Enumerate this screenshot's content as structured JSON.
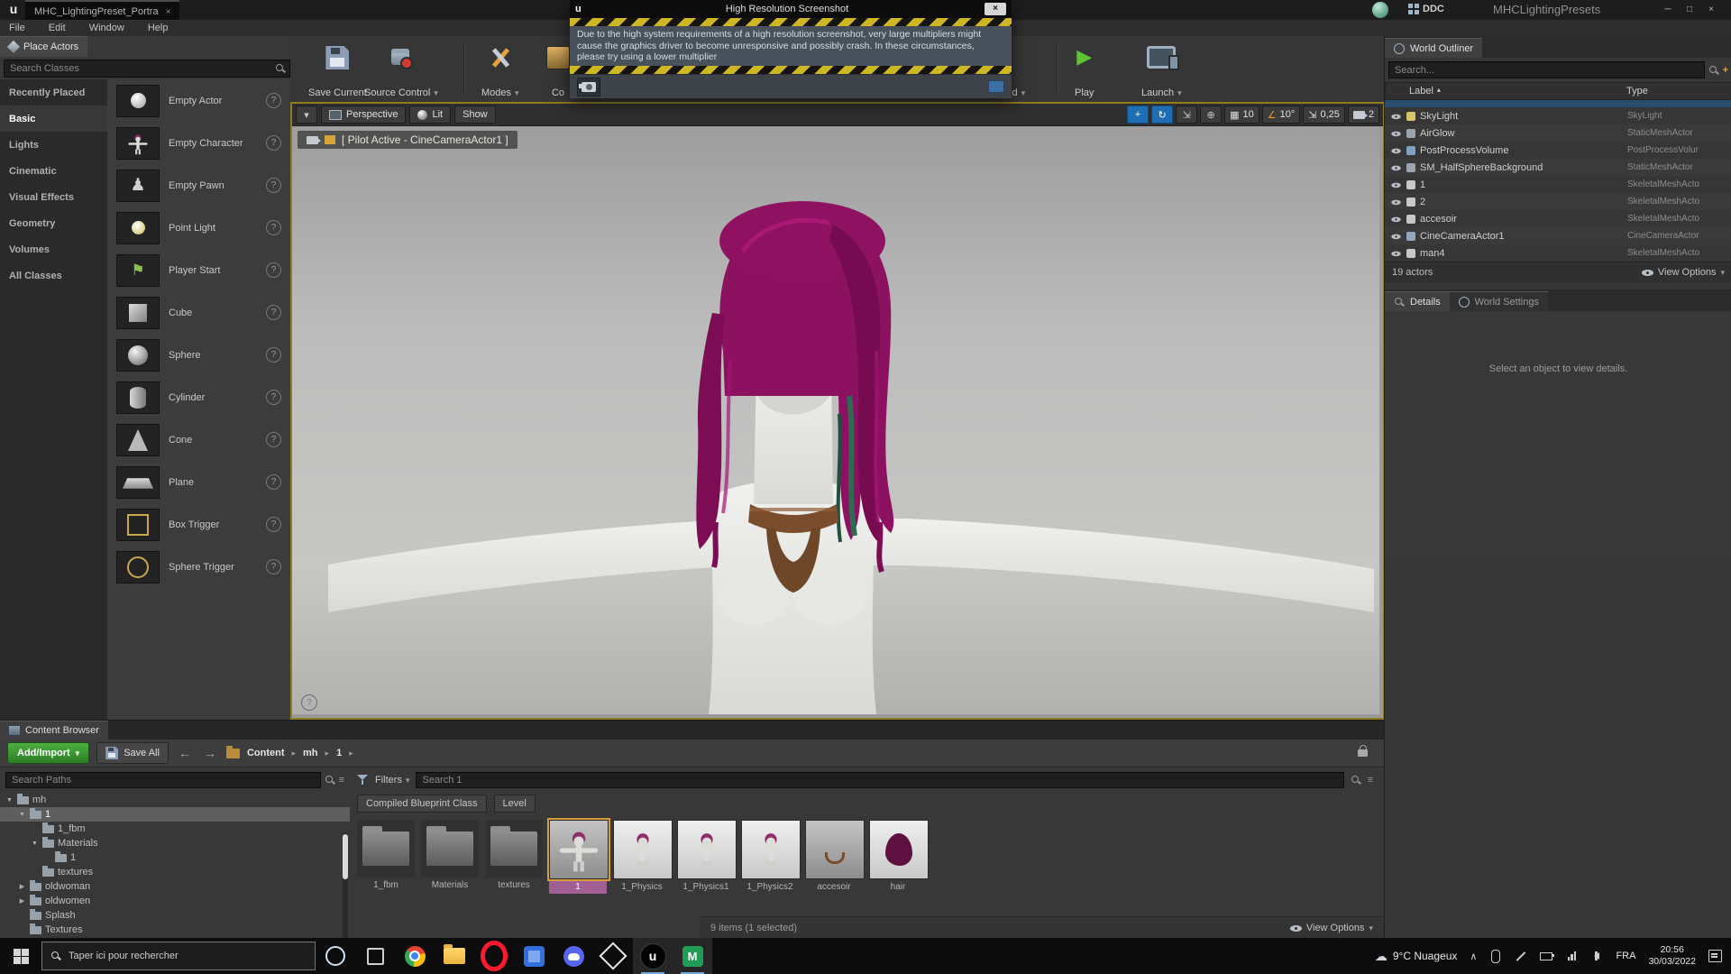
{
  "icons": {
    "ue": "u",
    "m": "M",
    "close": "×",
    "minimize": "─",
    "maximize": "□",
    "caret": "▾",
    "crumb": "▸",
    "back": "←",
    "forward": "→",
    "tree_open": "▼",
    "tree_closed": "▶",
    "play": "▶",
    "help": "?",
    "chevron_up": "∧",
    "list": "≡",
    "plus": "+",
    "rotate": "↻",
    "scale": "⇲",
    "globe": "⊕",
    "grid": "▦",
    "angle": "∠",
    "pawn": "♟",
    "flag": "⚑",
    "sort": "▴",
    "cloud": "☁"
  },
  "titlebar": {
    "tab": "MHC_LightingPreset_Portra",
    "ddc": "DDC",
    "app_title": "MHCLightingPresets"
  },
  "menubar": {
    "items": [
      "File",
      "Edit",
      "Window",
      "Help"
    ]
  },
  "place_actors": {
    "tab_title": "Place Actors",
    "search_placeholder": "Search Classes",
    "categories": [
      "Recently Placed",
      "Basic",
      "Lights",
      "Cinematic",
      "Visual Effects",
      "Geometry",
      "Volumes",
      "All Classes"
    ],
    "items": [
      "Empty Actor",
      "Empty Character",
      "Empty Pawn",
      "Point Light",
      "Player Start",
      "Cube",
      "Sphere",
      "Cylinder",
      "Cone",
      "Plane",
      "Box Trigger",
      "Sphere Trigger"
    ]
  },
  "toolbar": {
    "save_current": "Save Current",
    "source_control": "Source Control",
    "modes": "Modes",
    "content_label": "Co",
    "build_label": "ld",
    "play": "Play",
    "launch": "Launch"
  },
  "dialog": {
    "title": "High Resolution Screenshot",
    "body": "Due to the high system requirements of a high resolution screenshot, very large multipliers might cause the graphics driver to become unresponsive and possibly crash. In these circumstances, please try using a lower multiplier"
  },
  "viewport": {
    "perspective": "Perspective",
    "lit": "Lit",
    "show": "Show",
    "pilot": "[ Pilot Active - CineCameraActor1 ]",
    "grid_snap": "10",
    "rotation_snap": "10°",
    "scale_snap": "0,25",
    "camera_speed": "2"
  },
  "outliner": {
    "tab_title": "World Outliner",
    "search_placeholder": "Search...",
    "columns": {
      "label": "Label",
      "type": "Type"
    },
    "rows": [
      {
        "label": "SkyLight",
        "type": "SkyLight"
      },
      {
        "label": "AirGlow",
        "type": "StaticMeshActor"
      },
      {
        "label": "PostProcessVolume",
        "type": "PostProcessVolur"
      },
      {
        "label": "SM_HalfSphereBackground",
        "type": "StaticMeshActor"
      },
      {
        "label": "1",
        "type": "SkeletalMeshActo"
      },
      {
        "label": "2",
        "type": "SkeletalMeshActo"
      },
      {
        "label": "accesoir",
        "type": "SkeletalMeshActo"
      },
      {
        "label": "CineCameraActor1",
        "type": "CineCameraActor"
      },
      {
        "label": "man4",
        "type": "SkeletalMeshActo"
      }
    ],
    "status": "19 actors",
    "view_options": "View Options"
  },
  "details": {
    "tab_details": "Details",
    "tab_world_settings": "World Settings",
    "empty_text": "Select an object to view details."
  },
  "content_browser": {
    "tab_title": "Content Browser",
    "add_import": "Add/Import",
    "save_all": "Save All",
    "breadcrumbs": [
      "Content",
      "mh",
      "1"
    ],
    "search_paths_placeholder": "Search Paths",
    "filters_label": "Filters",
    "search_placeholder": "Search 1",
    "chips": [
      "Compiled Blueprint Class",
      "Level"
    ],
    "tree": [
      {
        "label": "mh"
      },
      {
        "label": "1"
      },
      {
        "label": "1_fbm"
      },
      {
        "label": "Materials"
      },
      {
        "label": "1"
      },
      {
        "label": "textures"
      },
      {
        "label": "oldwoman"
      },
      {
        "label": "oldwomen"
      },
      {
        "label": "Splash"
      },
      {
        "label": "Textures"
      }
    ],
    "assets": [
      {
        "name": "1_fbm"
      },
      {
        "name": "Materials"
      },
      {
        "name": "textures"
      },
      {
        "name": "1"
      },
      {
        "name": "1_Physics"
      },
      {
        "name": "1_Physics1"
      },
      {
        "name": "1_Physics2"
      },
      {
        "name": "accesoir"
      },
      {
        "name": "hair"
      }
    ],
    "status": "9 items (1 selected)",
    "view_options": "View Options"
  },
  "taskbar": {
    "search_placeholder": "Taper ici pour rechercher",
    "weather": "9°C Nuageux",
    "language": "FRA",
    "time": "20:56",
    "date": "30/03/2022"
  }
}
